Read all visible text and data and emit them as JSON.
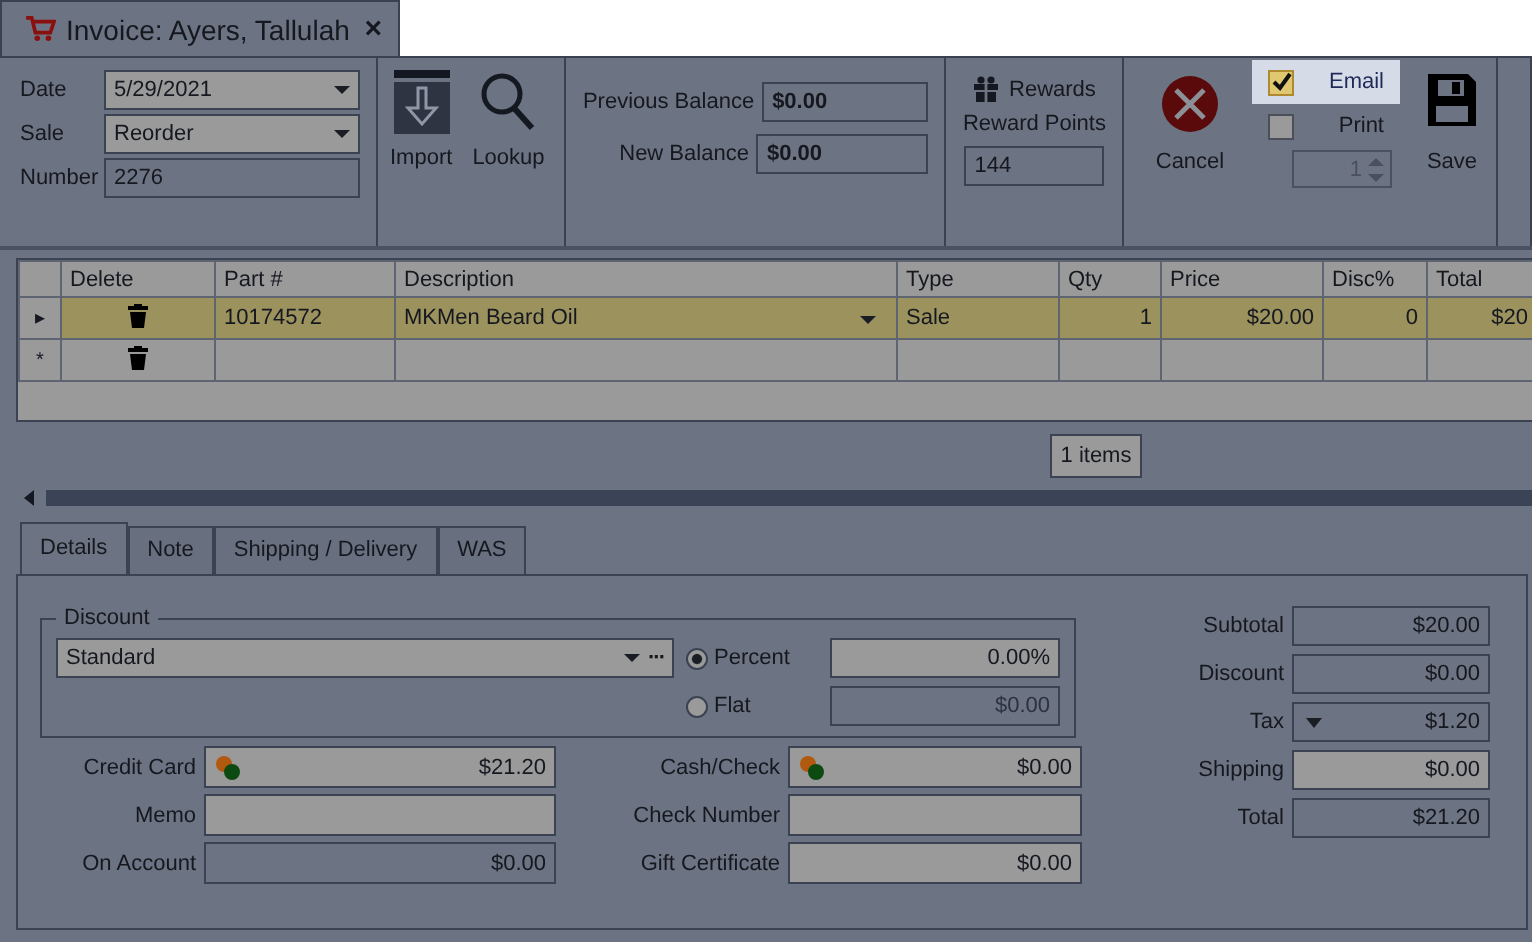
{
  "document_tab": {
    "title": "Invoice: Ayers, Tallulah",
    "close": "×"
  },
  "header": {
    "fields": [
      {
        "label": "Date",
        "value": "5/29/2021",
        "kind": "dropdown"
      },
      {
        "label": "Sale",
        "value": "Reorder",
        "kind": "dropdown"
      },
      {
        "label": "Number",
        "value": "2276",
        "kind": "readonly"
      }
    ],
    "tools": [
      {
        "label": "Import",
        "kind": "import"
      },
      {
        "label": "Lookup",
        "kind": "search"
      }
    ],
    "balances": [
      {
        "label": "Previous Balance",
        "value": "$0.00"
      },
      {
        "label": "New Balance",
        "value": "$0.00"
      }
    ],
    "rewards": {
      "title": "Rewards",
      "points_label": "Reward Points",
      "points": "144"
    },
    "cancel": {
      "label": "Cancel"
    },
    "outputs": [
      {
        "label": "Email",
        "checked": true,
        "highlighted": true
      },
      {
        "label": "Print",
        "checked": false,
        "highlighted": false
      }
    ],
    "copies": "1",
    "save": {
      "label": "Save"
    }
  },
  "grid": {
    "columns": [
      "Delete",
      "Part #",
      "Description",
      "Type",
      "Qty",
      "Price",
      "Disc%",
      "Total"
    ],
    "rows": [
      {
        "selected": true,
        "marker": "▸",
        "part": "10174572",
        "description": "MKMen Beard Oil",
        "type": "Sale",
        "qty": "1",
        "price": "$20.00",
        "disc": "0",
        "total": "$20"
      }
    ],
    "new_row": {
      "marker": "*"
    },
    "item_count": "1 items"
  },
  "detail_tabs": [
    {
      "label": "Details",
      "selected": true
    },
    {
      "label": "Note",
      "selected": false
    },
    {
      "label": "Shipping / Delivery",
      "selected": false
    },
    {
      "label": "WAS",
      "selected": false
    }
  ],
  "discount": {
    "legend": "Discount",
    "preset": "Standard",
    "more": "···",
    "options": [
      {
        "label": "Percent",
        "selected": true,
        "value": "0.00%"
      },
      {
        "label": "Flat",
        "selected": false,
        "value": "$0.00"
      }
    ]
  },
  "payments": [
    [
      {
        "label": "Credit Card",
        "value": "$21.20",
        "kind": "coin",
        "readonly": false
      },
      {
        "label": "Memo",
        "kind": "plain",
        "readonly": false
      },
      {
        "label": "On Account",
        "value": "$0.00",
        "kind": "plain",
        "readonly": true
      }
    ],
    [
      {
        "label": "Cash/Check",
        "value": "$0.00",
        "kind": "coin",
        "readonly": false
      },
      {
        "label": "Check Number",
        "kind": "plain",
        "readonly": false
      },
      {
        "label": "Gift Certificate",
        "value": "$0.00",
        "kind": "plain",
        "readonly": false
      }
    ]
  ],
  "totals": [
    {
      "label": "Subtotal",
      "value": "$20.00",
      "readonly": true,
      "dropdown": false
    },
    {
      "label": "Discount",
      "value": "$0.00",
      "readonly": true,
      "dropdown": false
    },
    {
      "label": "Tax",
      "value": "$1.20",
      "readonly": true,
      "dropdown": true
    },
    {
      "label": "Shipping",
      "value": "$0.00",
      "readonly": false,
      "dropdown": false
    },
    {
      "label": "Total",
      "value": "$21.20",
      "readonly": true,
      "dropdown": false
    }
  ]
}
